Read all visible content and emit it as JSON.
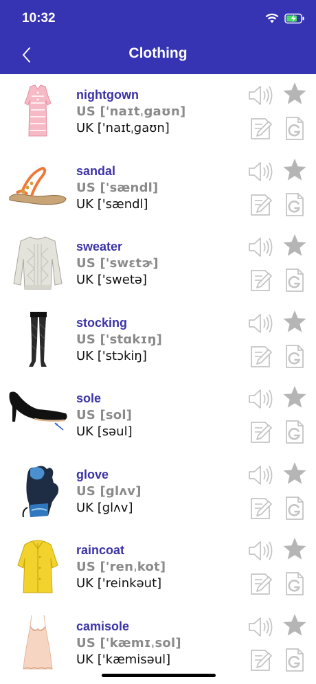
{
  "status_bar": {
    "time": "10:32"
  },
  "nav": {
    "title": "Clothing"
  },
  "colors": {
    "header": "#3634b3",
    "word": "#3b33a6",
    "icon_gray": "#c4c4c4"
  },
  "items": [
    {
      "word": "nightgown",
      "us": "US ['naɪtˌgaʊn]",
      "uk": "UK ['naɪtˌgaʊn]",
      "image": "nightgown"
    },
    {
      "word": "sandal",
      "us": "US ['sændl]",
      "uk": "UK ['sændl]",
      "image": "sandal"
    },
    {
      "word": "sweater",
      "us": "US ['swɛtɚ]",
      "uk": "UK ['swetə]",
      "image": "sweater"
    },
    {
      "word": "stocking",
      "us": "US ['stɑkɪŋ]",
      "uk": "UK ['stɔkiŋ]",
      "image": "stocking"
    },
    {
      "word": "sole",
      "us": "US [sol]",
      "uk": "UK [səul]",
      "image": "sole"
    },
    {
      "word": "glove",
      "us": "US [glʌv]",
      "uk": "UK [glʌv]",
      "image": "glove"
    },
    {
      "word": "raincoat",
      "us": "US ['renˌkot]",
      "uk": "UK ['reinkəut]",
      "image": "raincoat"
    },
    {
      "word": "camisole",
      "us": "US ['kæmɪˌsol]",
      "uk": "UK ['kæmisəul]",
      "image": "camisole"
    }
  ]
}
